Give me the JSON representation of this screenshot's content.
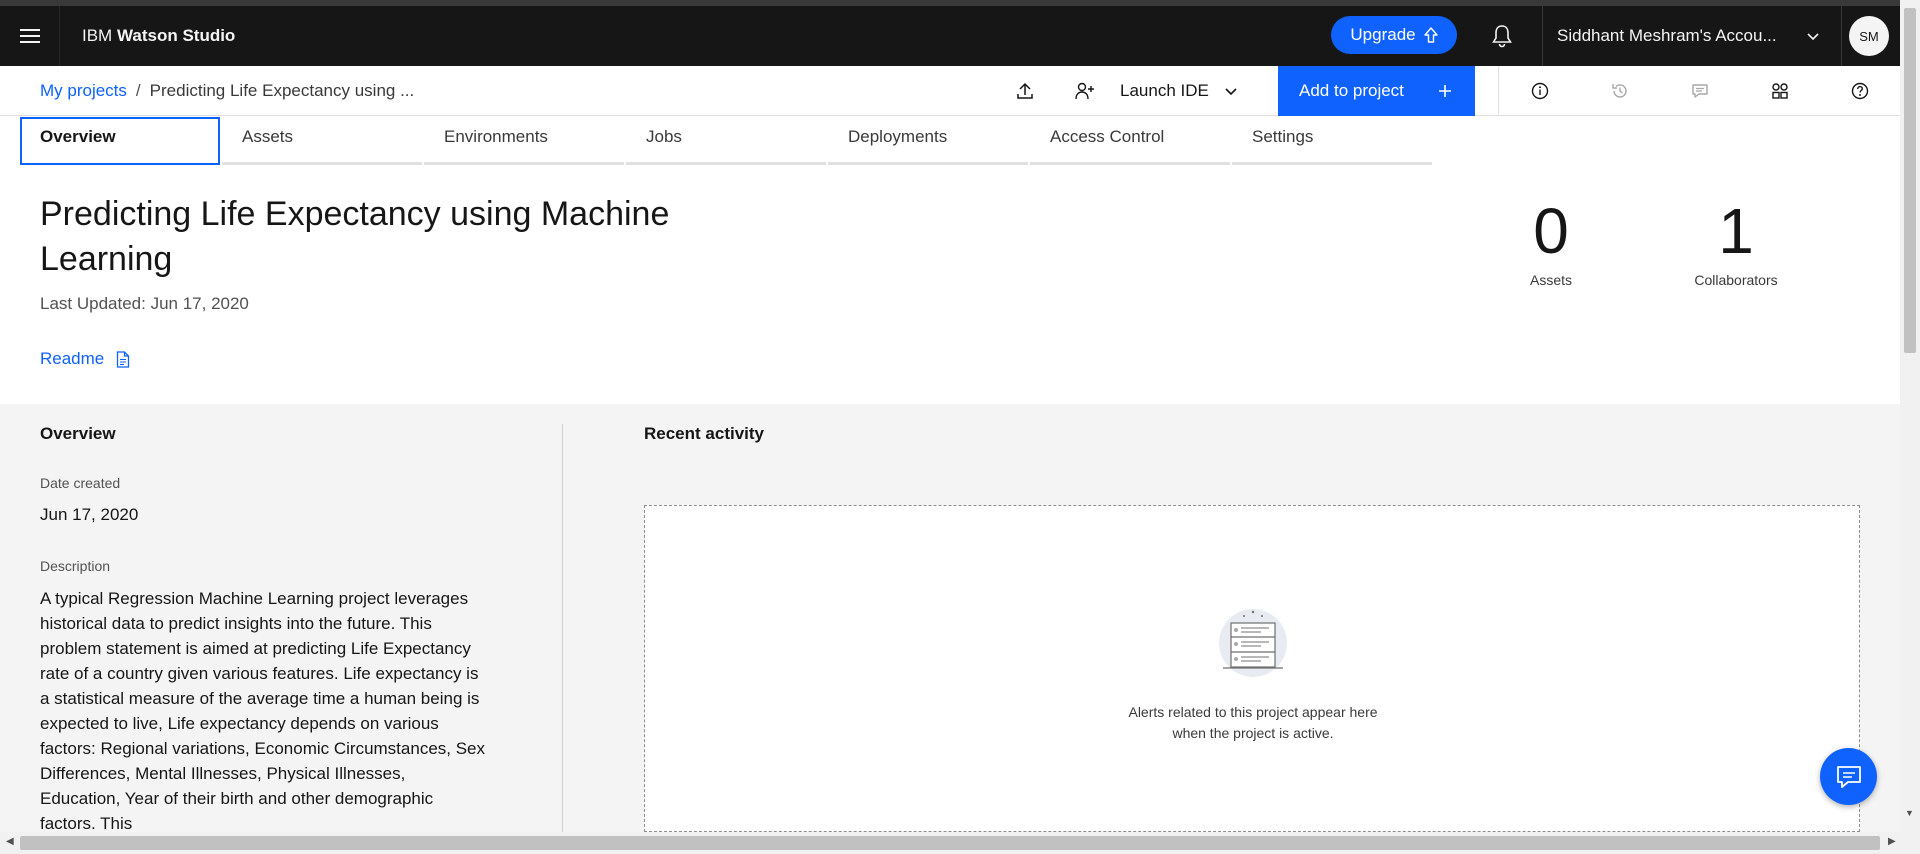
{
  "header": {
    "brand_prefix": "IBM",
    "brand_name": "Watson Studio",
    "upgrade_label": "Upgrade",
    "account_label": "Siddhant Meshram's Accou...",
    "avatar_initials": "SM"
  },
  "breadcrumb": {
    "root": "My projects",
    "separator": "/",
    "current": "Predicting Life Expectancy using ..."
  },
  "toolbar": {
    "launch_ide_label": "Launch IDE",
    "add_to_project_label": "Add to project",
    "icons": [
      "upload-icon",
      "add-collaborator-icon",
      "info-icon",
      "history-icon",
      "comments-icon",
      "apps-icon",
      "help-icon"
    ]
  },
  "tabs": [
    "Overview",
    "Assets",
    "Environments",
    "Jobs",
    "Deployments",
    "Access Control",
    "Settings"
  ],
  "project": {
    "title": "Predicting Life Expectancy using Machine Learning",
    "last_updated": "Last Updated: Jun 17, 2020",
    "readme_label": "Readme"
  },
  "stats": {
    "assets_value": "0",
    "assets_label": "Assets",
    "collaborators_value": "1",
    "collaborators_label": "Collaborators"
  },
  "overview": {
    "heading": "Overview",
    "date_created_label": "Date created",
    "date_created_value": "Jun 17, 2020",
    "description_label": "Description",
    "description": "A typical Regression Machine Learning project leverages historical data to predict insights into the future. This problem statement is aimed at predicting Life Expectancy rate of a country given various features. Life expectancy is a statistical measure of the average time a human being is expected to live, Life expectancy depends on various factors: Regional variations, Economic Circumstances, Sex Differences, Mental Illnesses, Physical Illnesses, Education, Year of their birth and other demographic factors. This"
  },
  "recent_activity": {
    "heading": "Recent activity",
    "empty_line1": "Alerts related to this project appear here",
    "empty_line2": "when the project is active."
  },
  "colors": {
    "topbar": "#161616",
    "accent": "#0f62fe",
    "panel_bg": "#f4f4f4"
  }
}
